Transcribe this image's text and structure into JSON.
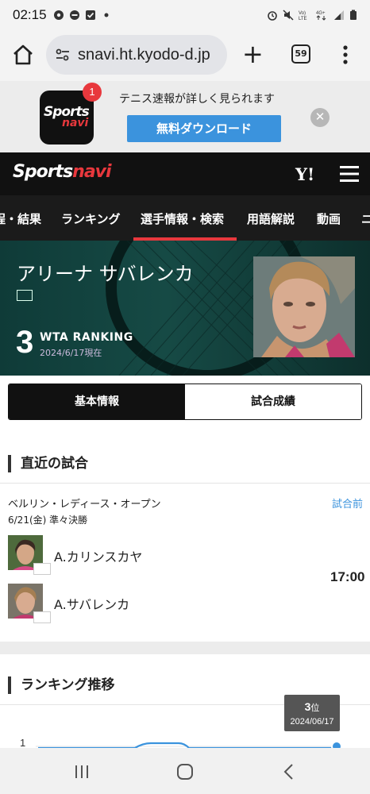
{
  "status_bar": {
    "time": "02:15"
  },
  "browser": {
    "url": "snavi.ht.kyodo-d.jp",
    "tab_count": "59"
  },
  "app_banner": {
    "app_icon_line1": "Sports",
    "app_icon_line2": "navi",
    "badge_count": "1",
    "text": "テニス速報が詳しく見られます",
    "download_label": "無料ダウンロード",
    "close_glyph": "✕"
  },
  "site": {
    "logo_sports": "Sports",
    "logo_navi": "navi",
    "yahoo": "Y!"
  },
  "nav": {
    "tabs": [
      "程・結果",
      "ランキング",
      "選手情報・検索",
      "用語解説",
      "動画",
      "ニ"
    ],
    "active_index": 2
  },
  "player": {
    "name": "アリーナ サバレンカ",
    "rank": "3",
    "rank_label": "WTA RANKING",
    "rank_date": "2024/6/17現在"
  },
  "segments": {
    "basic": "基本情報",
    "results": "試合成績"
  },
  "recent_matches": {
    "title": "直近の試合",
    "tournament": "ベルリン・レディース・オープン",
    "status": "試合前",
    "round": "6/21(金) 準々決勝",
    "player1": "A.カリンスカヤ",
    "player2": "A.サバレンカ",
    "time": "17:00"
  },
  "ranking_trend": {
    "title": "ランキング推移",
    "y_tick": "1",
    "tooltip_rank": "3",
    "tooltip_unit": "位",
    "tooltip_date": "2024/06/17"
  },
  "colors": {
    "brand_red": "#e8383d",
    "accent_blue": "#3b93dd",
    "hero_green": "#164a45"
  }
}
